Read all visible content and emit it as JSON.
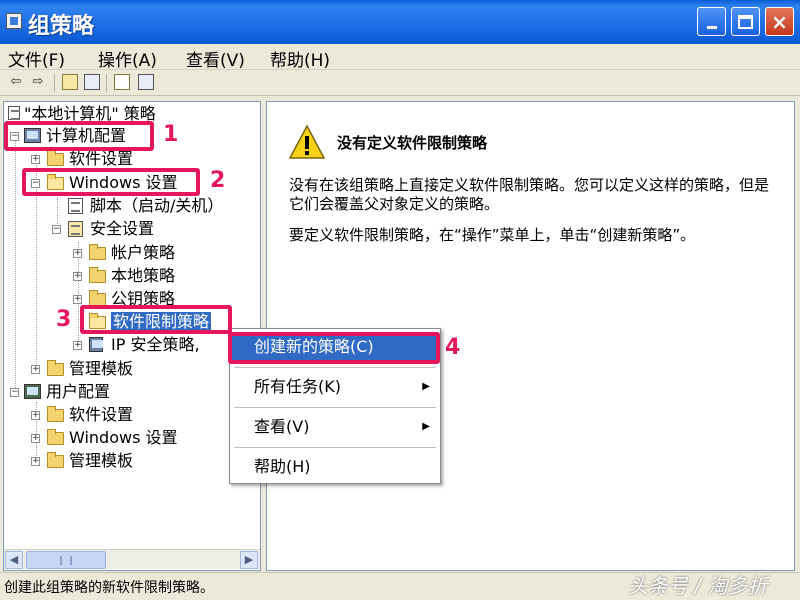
{
  "window": {
    "title": "组策略",
    "min": "_",
    "max": "□",
    "close": "×"
  },
  "menubar": [
    "文件(F)",
    "操作(A)",
    "查看(V)",
    "帮助(H)"
  ],
  "tree": {
    "root": "\"本地计算机\" 策略",
    "computer_config": "计算机配置",
    "software_settings": "软件设置",
    "windows_settings": "Windows 设置",
    "scripts": "脚本（启动/关机）",
    "security_settings": "安全设置",
    "account_policy": "帐户策略",
    "local_policy": "本地策略",
    "public_key_policy": "公钥策略",
    "software_restriction": "软件限制策略",
    "ip_security": "IP 安全策略,",
    "admin_templates": "管理模板",
    "user_config": "用户配置",
    "user_software_settings": "软件设置",
    "user_windows_settings": "Windows 设置",
    "user_admin_templates": "管理模板"
  },
  "detail": {
    "heading": "没有定义软件限制策略",
    "para1": "没有在该组策略上直接定义软件限制策略。您可以定义这样的策略，但是它们会覆盖父对象定义的策略。",
    "para2": "要定义软件限制策略，在“操作”菜单上，单击“创建新策略”。"
  },
  "context_menu": {
    "create_new": "创建新的策略(C)",
    "all_tasks": "所有任务(K)",
    "view": "查看(V)",
    "help": "帮助(H)"
  },
  "annotations": [
    "1",
    "2",
    "3",
    "4"
  ],
  "status": "创建此组策略的新软件限制策略。",
  "watermark": "头条号 / 淘多折"
}
